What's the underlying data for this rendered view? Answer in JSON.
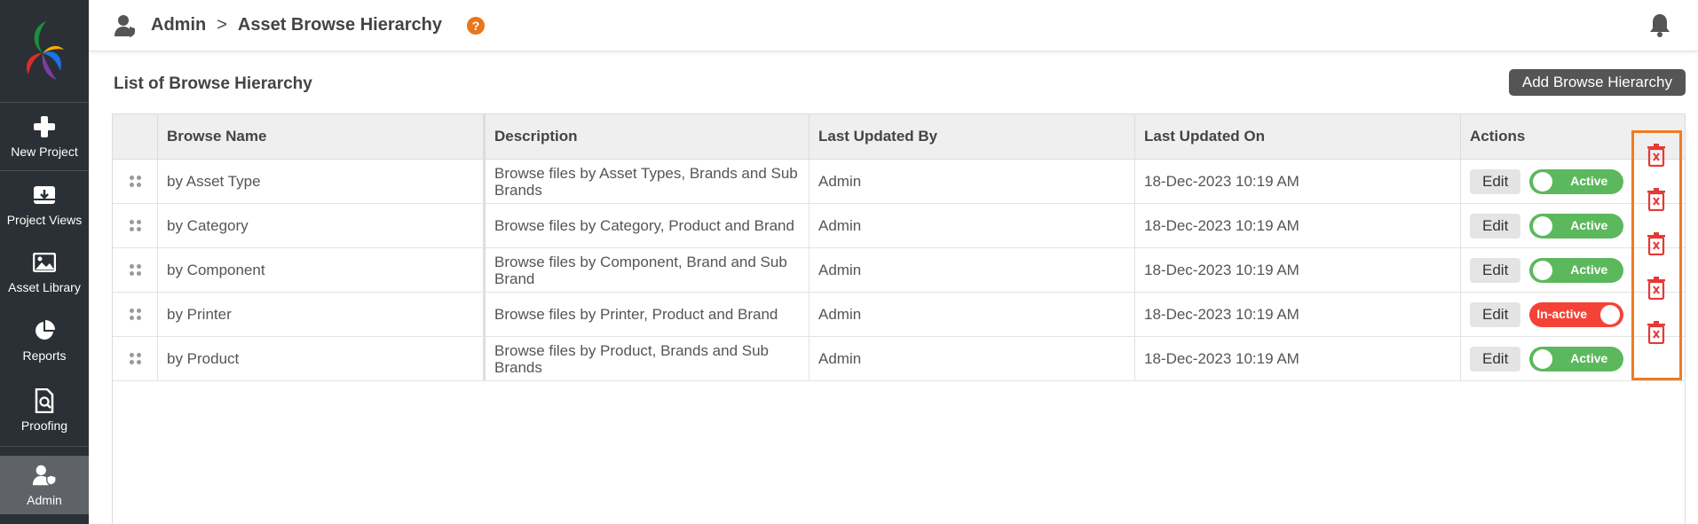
{
  "sidebar": {
    "items": [
      {
        "label": "New Project",
        "icon": "plus-icon"
      },
      {
        "label": "Project Views",
        "icon": "archive-icon"
      },
      {
        "label": "Asset Library",
        "icon": "image-icon"
      },
      {
        "label": "Reports",
        "icon": "pie-chart-icon"
      },
      {
        "label": "Proofing",
        "icon": "proof-search-icon"
      },
      {
        "label": "Admin",
        "icon": "user-shield-icon",
        "active": true
      }
    ]
  },
  "header": {
    "crumb_root": "Admin",
    "crumb_separator": ">",
    "crumb_current": "Asset Browse Hierarchy",
    "help": "?"
  },
  "main": {
    "title": "List of Browse Hierarchy",
    "add_button": "Add Browse Hierarchy",
    "columns": [
      "Browse Name",
      "Description",
      "Last Updated By",
      "Last Updated On",
      "Actions"
    ],
    "edit_label": "Edit",
    "rows": [
      {
        "name": "by Asset Type",
        "description": "Browse files by Asset Types, Brands and Sub Brands",
        "updated_by": "Admin",
        "updated_on": "18-Dec-2023 10:19 AM",
        "status": "Active"
      },
      {
        "name": "by Category",
        "description": "Browse files by Category, Product and Brand",
        "updated_by": "Admin",
        "updated_on": "18-Dec-2023 10:19 AM",
        "status": "Active"
      },
      {
        "name": "by Component",
        "description": "Browse files by Component, Brand and Sub Brand",
        "updated_by": "Admin",
        "updated_on": "18-Dec-2023 10:19 AM",
        "status": "Active"
      },
      {
        "name": "by Printer",
        "description": "Browse files by Printer, Product and Brand",
        "updated_by": "Admin",
        "updated_on": "18-Dec-2023 10:19 AM",
        "status": "In-active"
      },
      {
        "name": "by Product",
        "description": "Browse files by Product, Brands and Sub Brands",
        "updated_by": "Admin",
        "updated_on": "18-Dec-2023 10:19 AM",
        "status": "Active"
      }
    ]
  },
  "colors": {
    "sidebar_bg": "#2b3036",
    "active_toggle": "#5cb85c",
    "inactive_toggle": "#f44336",
    "delete_icon": "#e53935",
    "highlight_border": "#f07b22"
  }
}
